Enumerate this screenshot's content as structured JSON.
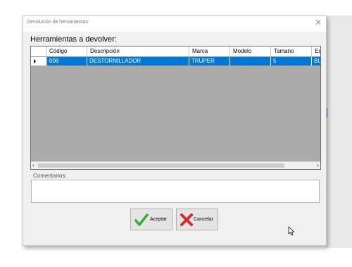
{
  "window": {
    "title": "Devolución de herramientas",
    "close_glyph": "✕"
  },
  "grid": {
    "heading": "Herramientas a devolver:",
    "columns": [
      "Código",
      "Descripción",
      "Marca",
      "Modelo",
      "Tamano",
      "Es"
    ],
    "rows": [
      {
        "codigo": "006",
        "descripcion": "DESTORNILLADOR",
        "marca": "TRUPER",
        "modelo": "",
        "tamano": "5",
        "es": "BU"
      }
    ]
  },
  "comments": {
    "label": "Comentarios:",
    "value": ""
  },
  "buttons": {
    "accept_label": "Aceptar",
    "cancel_label": "Cancelar"
  },
  "icons": {
    "accept": "checkmark-icon",
    "cancel": "red-x-icon",
    "row_selector": "row-arrow-icon"
  },
  "colors": {
    "selection": "#0078d7",
    "grid_background": "#ababab",
    "accept_icon": "#3ca83c",
    "cancel_icon": "#d62b2b"
  }
}
